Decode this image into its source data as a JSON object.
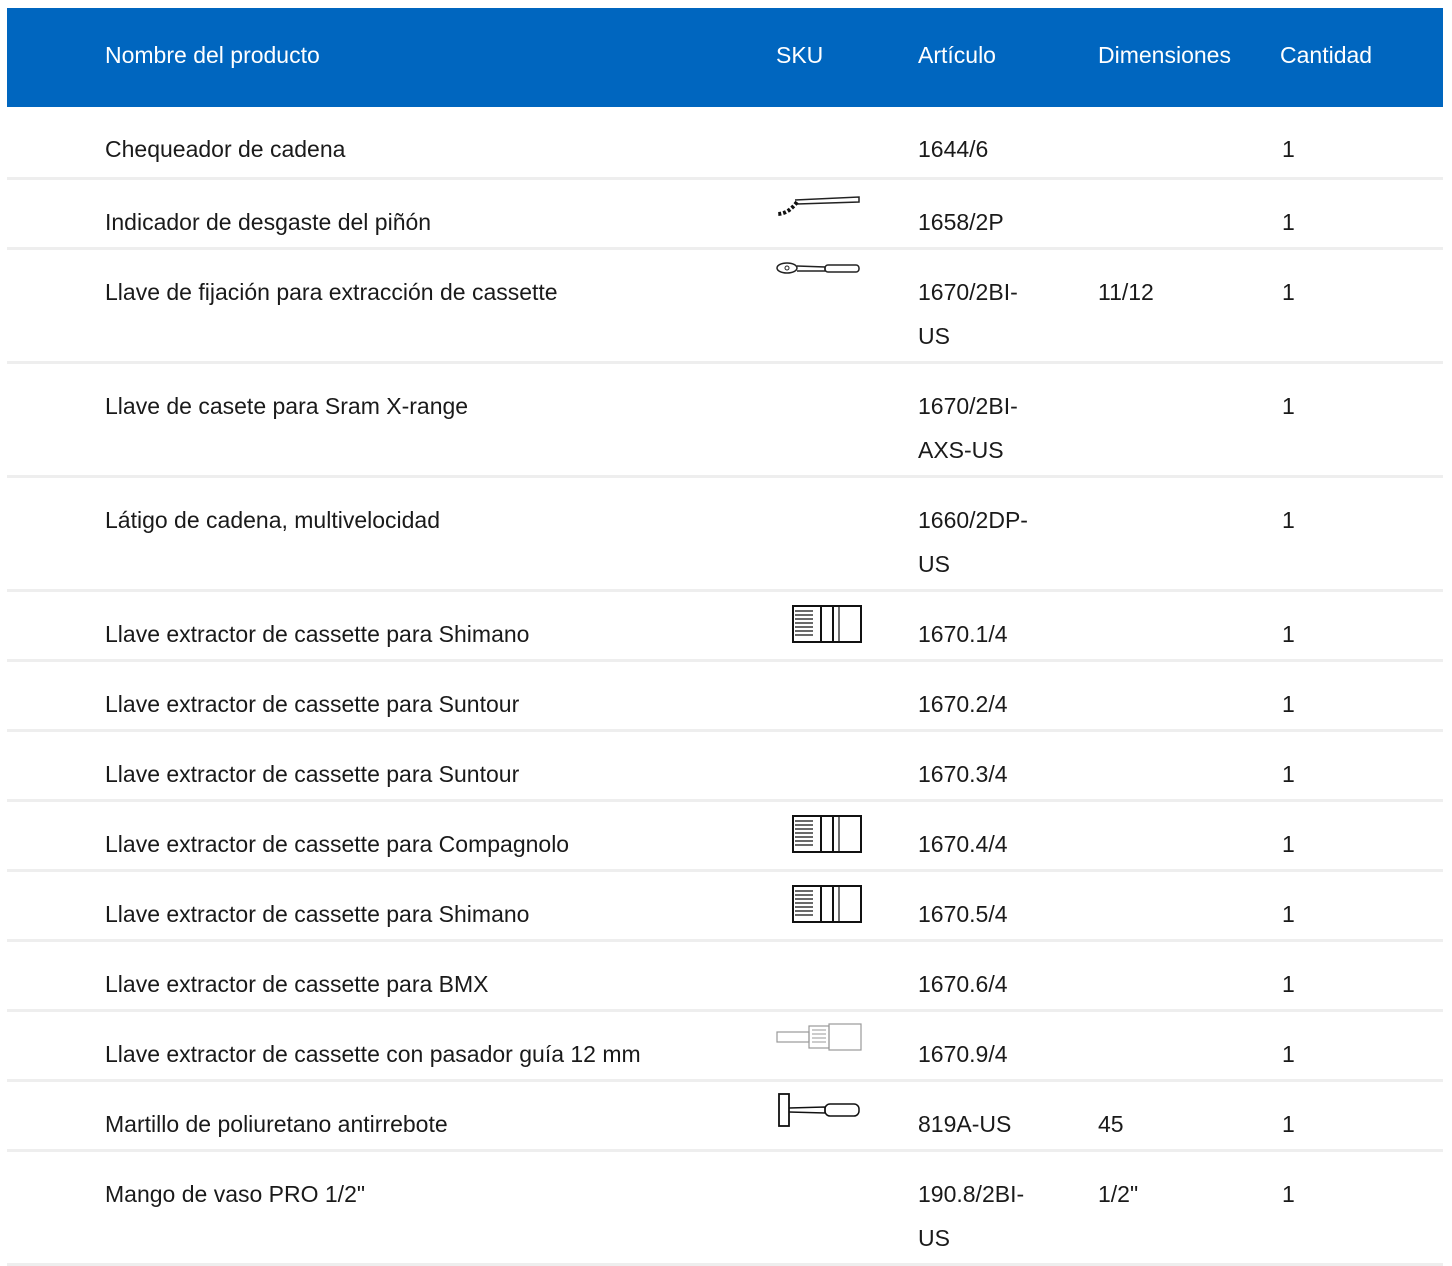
{
  "header": {
    "name": "Nombre del producto",
    "sku": "SKU",
    "article": "Artículo",
    "dimensions": "Dimensiones",
    "quantity": "Cantidad"
  },
  "colors": {
    "header_bg": "#0066bf",
    "header_text": "#ffffff",
    "divider": "#eeeeee"
  },
  "rows": [
    {
      "name": "Chequeador de cadena",
      "article": "1644/6",
      "dimensions": "",
      "quantity": "1",
      "sku_icon": ""
    },
    {
      "name": "Indicador de desgaste del piñón",
      "article": "1658/2P",
      "dimensions": "",
      "quantity": "1",
      "sku_icon": "chain-whip-icon"
    },
    {
      "name": "Llave de fijación para extracción de cassette",
      "article": "1670/2BI-US",
      "dimensions": "11/12",
      "quantity": "1",
      "sku_icon": "wrench-icon"
    },
    {
      "name": "Llave de casete para Sram X-range",
      "article": "1670/2BI-AXS-US",
      "dimensions": "",
      "quantity": "1",
      "sku_icon": ""
    },
    {
      "name": "Látigo de cadena, multivelocidad",
      "article": "1660/2DP-US",
      "dimensions": "",
      "quantity": "1",
      "sku_icon": ""
    },
    {
      "name": "Llave extractor de cassette para Shimano",
      "article": "1670.1/4",
      "dimensions": "",
      "quantity": "1",
      "sku_icon": "cassette-tool-icon"
    },
    {
      "name": "Llave extractor de cassette para Suntour",
      "article": "1670.2/4",
      "dimensions": "",
      "quantity": "1",
      "sku_icon": ""
    },
    {
      "name": "Llave extractor de cassette para Suntour",
      "article": "1670.3/4",
      "dimensions": "",
      "quantity": "1",
      "sku_icon": ""
    },
    {
      "name": "Llave extractor de cassette para Compagnolo",
      "article": "1670.4/4",
      "dimensions": "",
      "quantity": "1",
      "sku_icon": "cassette-tool-icon"
    },
    {
      "name": "Llave extractor de cassette para Shimano",
      "article": "1670.5/4",
      "dimensions": "",
      "quantity": "1",
      "sku_icon": "cassette-tool-icon"
    },
    {
      "name": "Llave extractor de cassette para BMX",
      "article": "1670.6/4",
      "dimensions": "",
      "quantity": "1",
      "sku_icon": ""
    },
    {
      "name": "Llave extractor de cassette con pasador guía 12 mm",
      "article": "1670.9/4",
      "dimensions": "",
      "quantity": "1",
      "sku_icon": "guide-pin-tool-icon"
    },
    {
      "name": "Martillo de poliuretano antirrebote",
      "article": "819A-US",
      "dimensions": "45",
      "quantity": "1",
      "sku_icon": "hammer-icon"
    },
    {
      "name": "Mango de vaso PRO 1/2\"",
      "article": "190.8/2BI-US",
      "dimensions": "1/2\"",
      "quantity": "1",
      "sku_icon": ""
    }
  ]
}
